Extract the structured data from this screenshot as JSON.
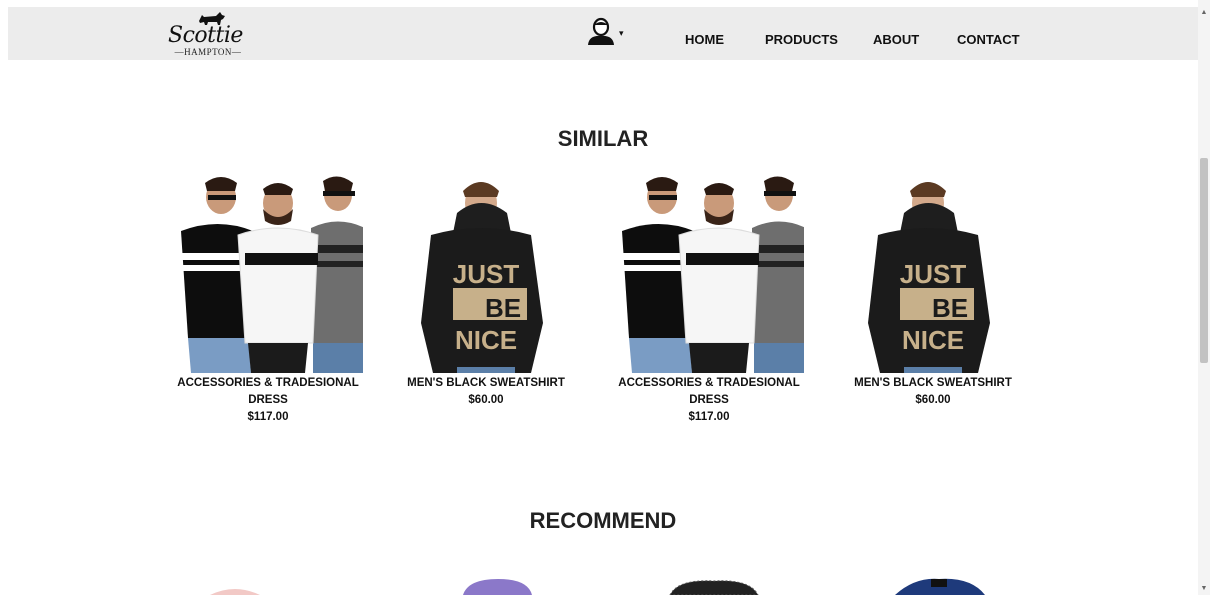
{
  "brand": {
    "logo_script": "Scottie",
    "logo_sub": "—HAMPTON—"
  },
  "nav": {
    "user_caret": "▾",
    "links": [
      "HOME",
      "PRODUCTS",
      "ABOUT",
      "CONTACT"
    ]
  },
  "similar": {
    "title": "SIMILAR",
    "products": [
      {
        "name": "ACCESSORIES & TRADESIONAL DRESS",
        "price": "$117.00",
        "image": "three-men-tshirts"
      },
      {
        "name": "MEN'S BLACK SWEATSHIRT",
        "price": "$60.00",
        "image": "black-hoodie"
      },
      {
        "name": "ACCESSORIES & TRADESIONAL DRESS",
        "price": "$117.00",
        "image": "three-men-tshirts"
      },
      {
        "name": "MEN'S BLACK SWEATSHIRT",
        "price": "$60.00",
        "image": "black-hoodie"
      }
    ],
    "hoodie_print": [
      "JUST",
      "BE",
      "NICE"
    ]
  },
  "recommend": {
    "title": "RECOMMEND",
    "products_partial": [
      "pink-item",
      "purple-item",
      "black-lace-item",
      "navy-item"
    ]
  },
  "colors": {
    "navbar_bg": "#ececec",
    "page_bg": "#ffffff",
    "text": "#111111"
  }
}
